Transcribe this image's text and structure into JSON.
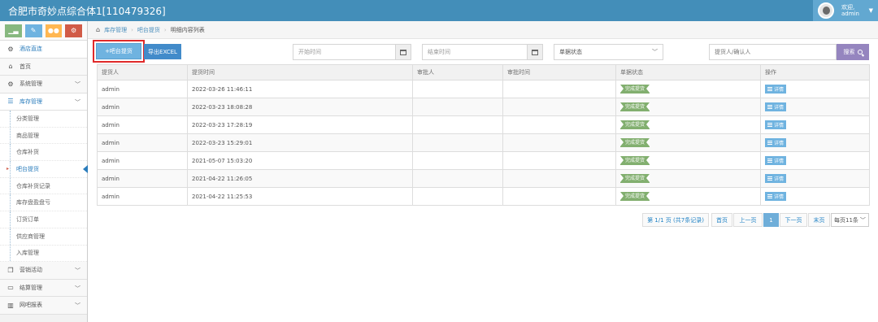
{
  "header": {
    "title": "合肥市奇妙点综合体1[110479326]",
    "welcome": "欢迎,",
    "user": "admin"
  },
  "sidebar": {
    "shortcuts": [
      "chart-icon",
      "pencil-icon",
      "users-icon",
      "cogs-icon"
    ],
    "items": [
      {
        "label": "酒店直连",
        "icon": "gear-icon"
      },
      {
        "label": "首页",
        "icon": "home-icon"
      },
      {
        "label": "系统管理",
        "icon": "gear-icon"
      },
      {
        "label": "库存管理",
        "icon": "database-icon"
      },
      {
        "label": "营销活动",
        "icon": "gift-icon"
      },
      {
        "label": "结算管理",
        "icon": "credit-card-icon"
      },
      {
        "label": "网吧报表",
        "icon": "bar-chart-icon"
      }
    ],
    "subitems": [
      "分类管理",
      "商品管理",
      "仓库补货",
      "吧台提货",
      "仓库补货记录",
      "库存盘盈盘亏",
      "订货订单",
      "供应商管理",
      "入库管理"
    ]
  },
  "breadcrumb": {
    "home": "库存管理",
    "second": "吧台提货",
    "current": "明细内容列表"
  },
  "toolbar": {
    "add_label": "+吧台提货",
    "export_label": "导出EXCEL",
    "start_placeholder": "开始时间",
    "end_placeholder": "结束时间",
    "status_value": "单据状态",
    "person_placeholder": "提货人/确认人",
    "search_label": "搜索"
  },
  "table": {
    "columns": [
      "提货人",
      "提货时间",
      "审批人",
      "审批时间",
      "单据状态",
      "操作"
    ],
    "rows": [
      {
        "person": "admin",
        "time": "2022-03-26 11:46:11",
        "approver": "",
        "approve_time": "",
        "status": "完成提货",
        "action": "详情"
      },
      {
        "person": "admin",
        "time": "2022-03-23 18:08:28",
        "approver": "",
        "approve_time": "",
        "status": "完成提货",
        "action": "详情"
      },
      {
        "person": "admin",
        "time": "2022-03-23 17:28:19",
        "approver": "",
        "approve_time": "",
        "status": "完成提货",
        "action": "详情"
      },
      {
        "person": "admin",
        "time": "2022-03-23 15:29:01",
        "approver": "",
        "approve_time": "",
        "status": "完成提货",
        "action": "详情"
      },
      {
        "person": "admin",
        "time": "2021-05-07 15:03:20",
        "approver": "",
        "approve_time": "",
        "status": "完成提货",
        "action": "详情"
      },
      {
        "person": "admin",
        "time": "2021-04-22 11:26:05",
        "approver": "",
        "approve_time": "",
        "status": "完成提货",
        "action": "详情"
      },
      {
        "person": "admin",
        "time": "2021-04-22 11:25:53",
        "approver": "",
        "approve_time": "",
        "status": "完成提货",
        "action": "详情"
      }
    ]
  },
  "pagination": {
    "summary": "第 1/1 页 (共7条记录)",
    "first": "首页",
    "prev": "上一页",
    "current": "1",
    "next": "下一页",
    "last": "末页",
    "per_page": "每页11条"
  },
  "colors": {
    "topbar": "#438eb9",
    "accent": "#6fb3e0",
    "status_done": "#82af6f",
    "search": "#9585bf",
    "highlight_box": "#e02a2a"
  }
}
